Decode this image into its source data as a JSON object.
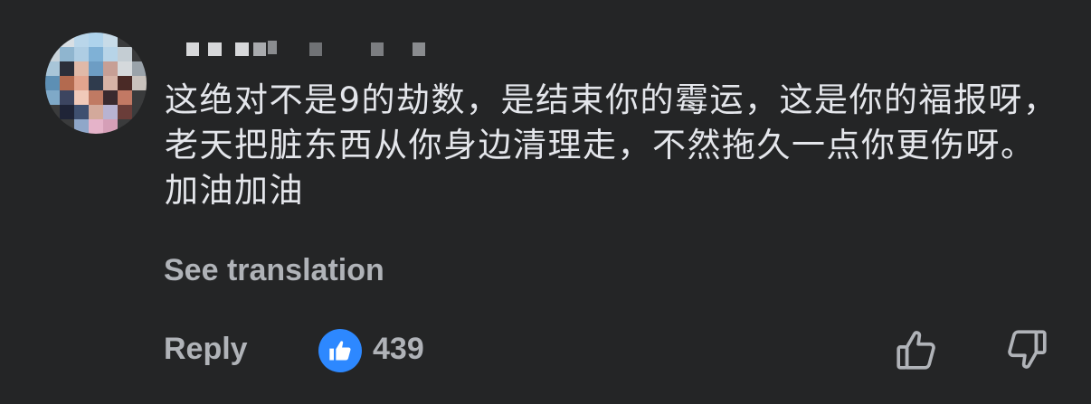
{
  "comment": {
    "author_name": "",
    "text": "这绝对不是9的劫数，是结束你的霉运，这是你的福报呀，老天把脏东西从你身边清理走，不然拖久一点你更伤呀。加油加油",
    "see_translation_label": "See translation",
    "reply_label": "Reply",
    "like_count": "439",
    "icons": {
      "reaction": "like-thumbs-up-icon",
      "like_action": "thumbs-up-outline-icon",
      "dislike_action": "thumbs-down-outline-icon"
    }
  },
  "colors": {
    "background": "#242526",
    "primary_text": "#e4e6eb",
    "secondary_text": "#b0b3b8",
    "accent": "#2d88ff"
  }
}
